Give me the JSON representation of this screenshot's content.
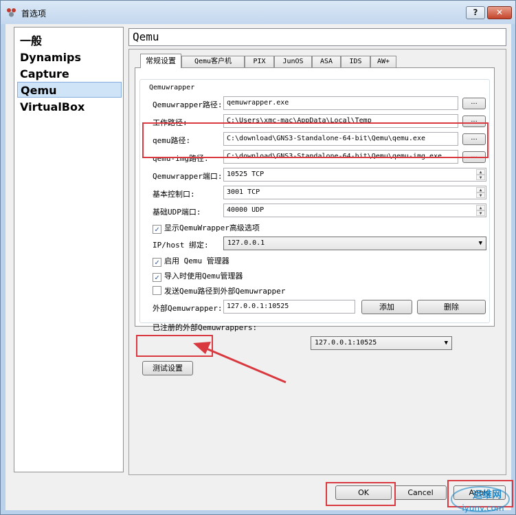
{
  "window": {
    "title": "首选项",
    "help_label": "?",
    "close_label": "✕"
  },
  "sidebar": {
    "items": [
      {
        "label": "一般"
      },
      {
        "label": "Dynamips"
      },
      {
        "label": "Capture"
      },
      {
        "label": "Qemu"
      },
      {
        "label": "VirtualBox"
      }
    ],
    "selected": "Qemu"
  },
  "panel_title": "Qemu",
  "tabs": [
    "常规设置",
    "Qemu客户机",
    "PIX",
    "JunOS",
    "ASA",
    "IDS",
    "AW+"
  ],
  "group_title": "Qemuwrapper",
  "fields": {
    "qemuwrapper_path": {
      "label": "Qemuwrapper路径:",
      "value": "qemuwrapper.exe"
    },
    "work_path": {
      "label": "工作路径:",
      "value": "C:\\Users\\xmc-mac\\AppData\\Local\\Temp"
    },
    "qemu_path": {
      "label": "qemu路径:",
      "value": "C:\\download\\GNS3-Standalone-64-bit\\Qemu\\qemu.exe"
    },
    "qemu_img_path": {
      "label": "qemu-img路径:",
      "value": "C:\\download\\GNS3-Standalone-64-bit\\Qemu\\qemu-img.exe"
    },
    "qemuwrapper_port": {
      "label": "Qemuwrapper端口:",
      "value": "10525 TCP"
    },
    "base_console_port": {
      "label": "基本控制口:",
      "value": "3001 TCP"
    },
    "base_udp_port": {
      "label": "基础UDP端口:",
      "value": "40000 UDP"
    },
    "ip_host_binding": {
      "label": "IP/host 绑定:",
      "value": "127.0.0.1"
    },
    "external_qemuwrapper": {
      "label": "外部Qemuwrapper:",
      "value": "127.0.0.1:10525"
    },
    "registered_external": {
      "label": "已注册的外部Qemuwrappers:",
      "value": "127.0.0.1:10525"
    }
  },
  "browse_label": "...",
  "checkboxes": [
    {
      "label": "显示QemuWrapper高级选项",
      "checked": true
    },
    {
      "label": "启用 Qemu 管理器",
      "checked": true
    },
    {
      "label": "导入时使用Qemu管理器",
      "checked": true
    },
    {
      "label": "发送Qemu路径到外部Qemuwrapper",
      "checked": false
    }
  ],
  "buttons": {
    "add": "添加",
    "delete": "删除",
    "test": "测试设置",
    "ok": "OK",
    "cancel": "Cancel",
    "apply": "Apply"
  },
  "watermark": {
    "text": "运维网",
    "url_text": "iyunv.com"
  },
  "colors": {
    "highlight_red": "#d9383f",
    "selection_bg": "#cfe4f7"
  }
}
